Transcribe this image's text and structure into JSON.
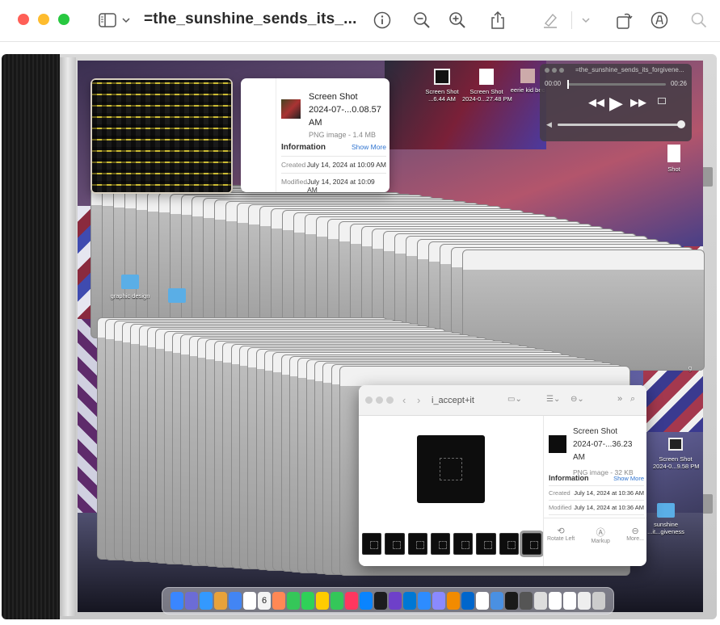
{
  "app": {
    "title": "=the_sunshine_sends_its_...",
    "toolbar": {
      "sidebar_toggle_icon": "sidebar-icon",
      "chevron_icon": "chevron-down-icon",
      "info_icon": "info-icon",
      "zoom_out_icon": "zoom-out-icon",
      "zoom_in_icon": "zoom-in-icon",
      "share_icon": "share-icon",
      "highlight_icon": "highlighter-icon",
      "rotate_icon": "rotate-icon",
      "markup_icon": "markup-icon",
      "search_icon": "search-icon"
    }
  },
  "preview_top": {
    "name_line1": "Screen Shot",
    "name_line2": "2024-07-...0.08.57 AM",
    "kind": "PNG image - 1.4 MB",
    "info_header": "Information",
    "show_more": "Show More",
    "created_label": "Created",
    "created_value": "July 14, 2024 at 10:09 AM",
    "modified_label": "Modified",
    "modified_value": "July 14, 2024 at 10:09 AM"
  },
  "desktop_icons": [
    {
      "label": "Screen Shot\n...6.44 AM"
    },
    {
      "label": "Screen Shot\n2024-0...27.48 PM"
    },
    {
      "label": "eerie kid bec"
    },
    {
      "label": "graphic design"
    },
    {
      "label": "Screen Shot\n2024-0...9.58 PM"
    },
    {
      "label": "sunshine\n...it...giveness"
    },
    {
      "label": "Shot"
    },
    {
      "label": "g"
    }
  ],
  "media_player": {
    "title": "=the_sunshine_sends_its_forgivene...",
    "time_elapsed": "00:00",
    "time_total": "00:26",
    "progress_fraction": 0.0,
    "volume_fraction": 0.98
  },
  "finder": {
    "folder": "i_accept+it",
    "name_line1": "Screen Shot",
    "name_line2": "2024-07-...36.23 AM",
    "kind": "PNG image - 32 KB",
    "info_header": "Information",
    "show_more": "Show More",
    "created_label": "Created",
    "created_value": "July 14, 2024 at 10:36 AM",
    "modified_label": "Modified",
    "modified_value": "July 14, 2024 at 10:36 AM",
    "actions": [
      {
        "label": "Rotate Left",
        "icon": "rotate-left-icon"
      },
      {
        "label": "Markup",
        "icon": "markup-icon"
      },
      {
        "label": "More...",
        "icon": "more-icon"
      }
    ]
  },
  "dock": {
    "calendar_day": "6"
  },
  "colors": {
    "close": "#ff5f57",
    "minimize": "#febc2e",
    "zoom": "#28c840",
    "link": "#2f74d0"
  }
}
